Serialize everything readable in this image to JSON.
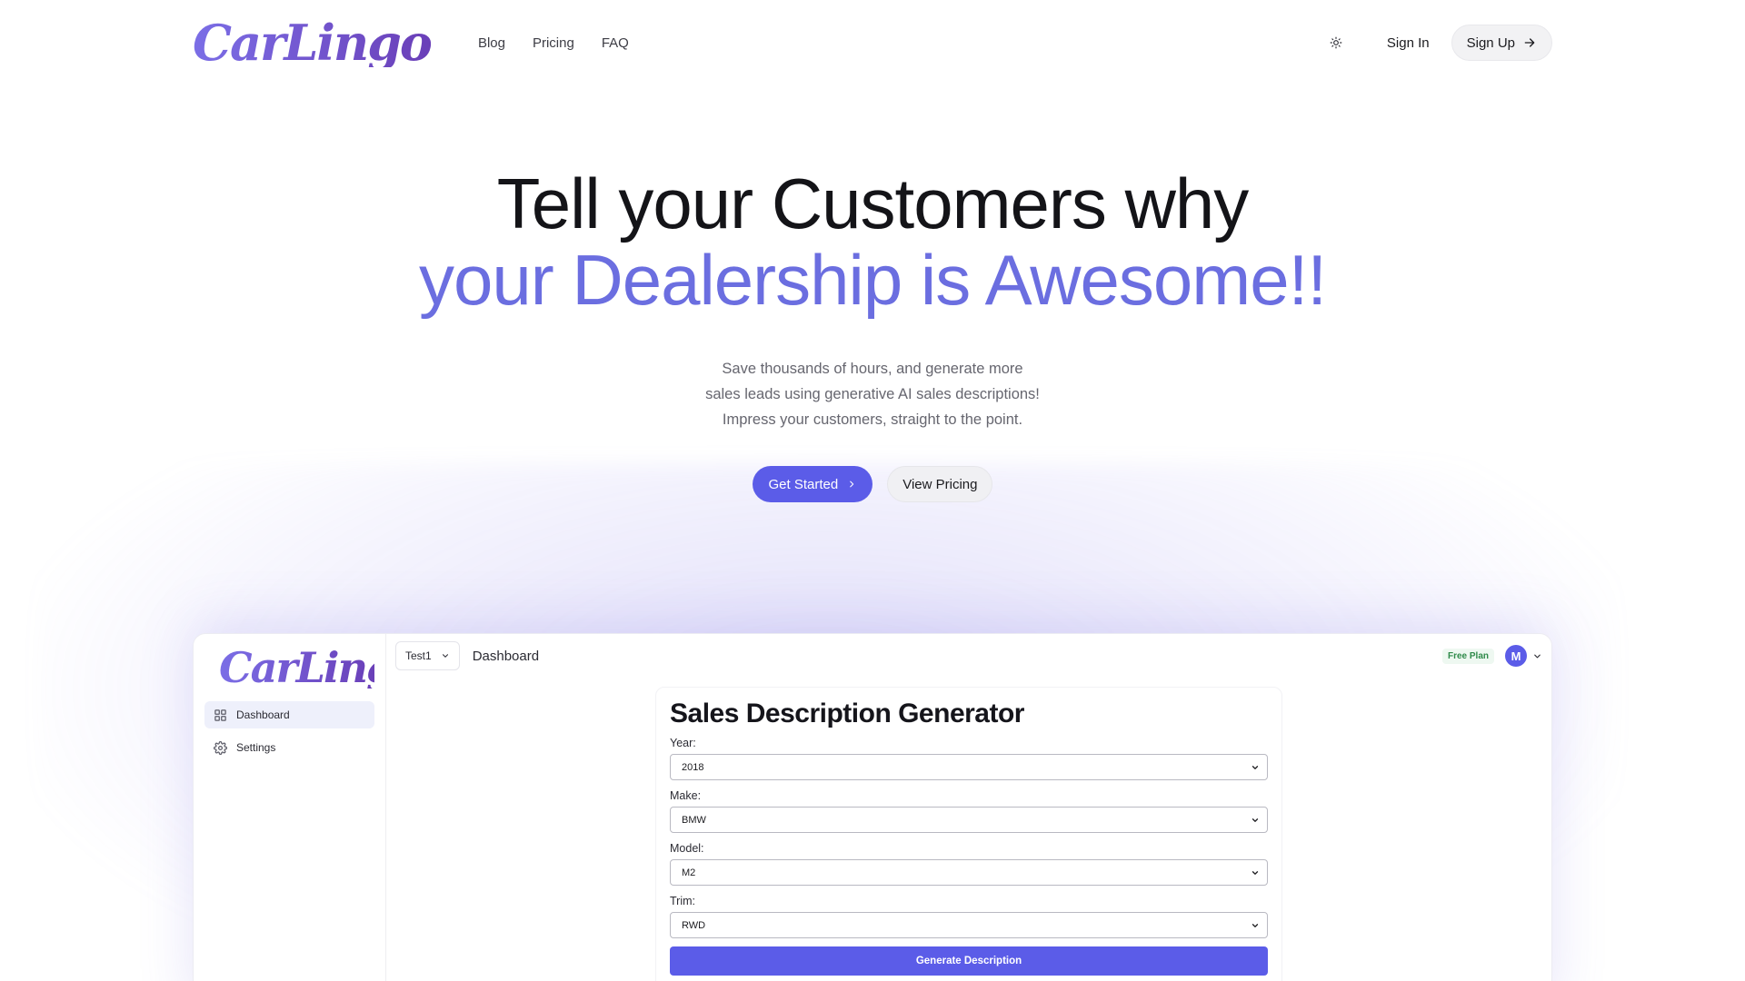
{
  "brand": {
    "logo_text": "CarLingo"
  },
  "nav": {
    "links": [
      "Blog",
      "Pricing",
      "FAQ"
    ],
    "theme_icon": "sun-icon",
    "sign_in": "Sign In",
    "sign_up": "Sign Up",
    "sign_up_icon": "arrow-right-icon"
  },
  "hero": {
    "title_line1": "Tell your Customers why",
    "title_line2": "your Dealership is Awesome!!",
    "subtitle_line1": "Save thousands of hours, and generate more",
    "subtitle_line2": "sales leads using generative AI sales descriptions!",
    "subtitle_line3": "Impress your customers, straight to the point.",
    "cta_primary": "Get Started",
    "cta_secondary": "View Pricing"
  },
  "app_preview": {
    "logo_text": "CarLingo",
    "sidebar": [
      {
        "label": "Dashboard",
        "icon": "grid-icon",
        "active": true
      },
      {
        "label": "Settings",
        "icon": "gear-icon",
        "active": false
      }
    ],
    "team": "Test1",
    "breadcrumb": "Dashboard",
    "plan_badge": "Free Plan",
    "avatar_initial": "M",
    "form": {
      "title": "Sales Description Generator",
      "fields": [
        {
          "label": "Year:",
          "value": "2018"
        },
        {
          "label": "Make:",
          "value": "BMW"
        },
        {
          "label": "Model:",
          "value": "M2"
        },
        {
          "label": "Trim:",
          "value": "RWD"
        }
      ],
      "submit": "Generate Description"
    }
  },
  "colors": {
    "accent": "#5b5ce8",
    "hero_accent": "#6b6ee0",
    "badge_green": "#2f8a4a"
  }
}
